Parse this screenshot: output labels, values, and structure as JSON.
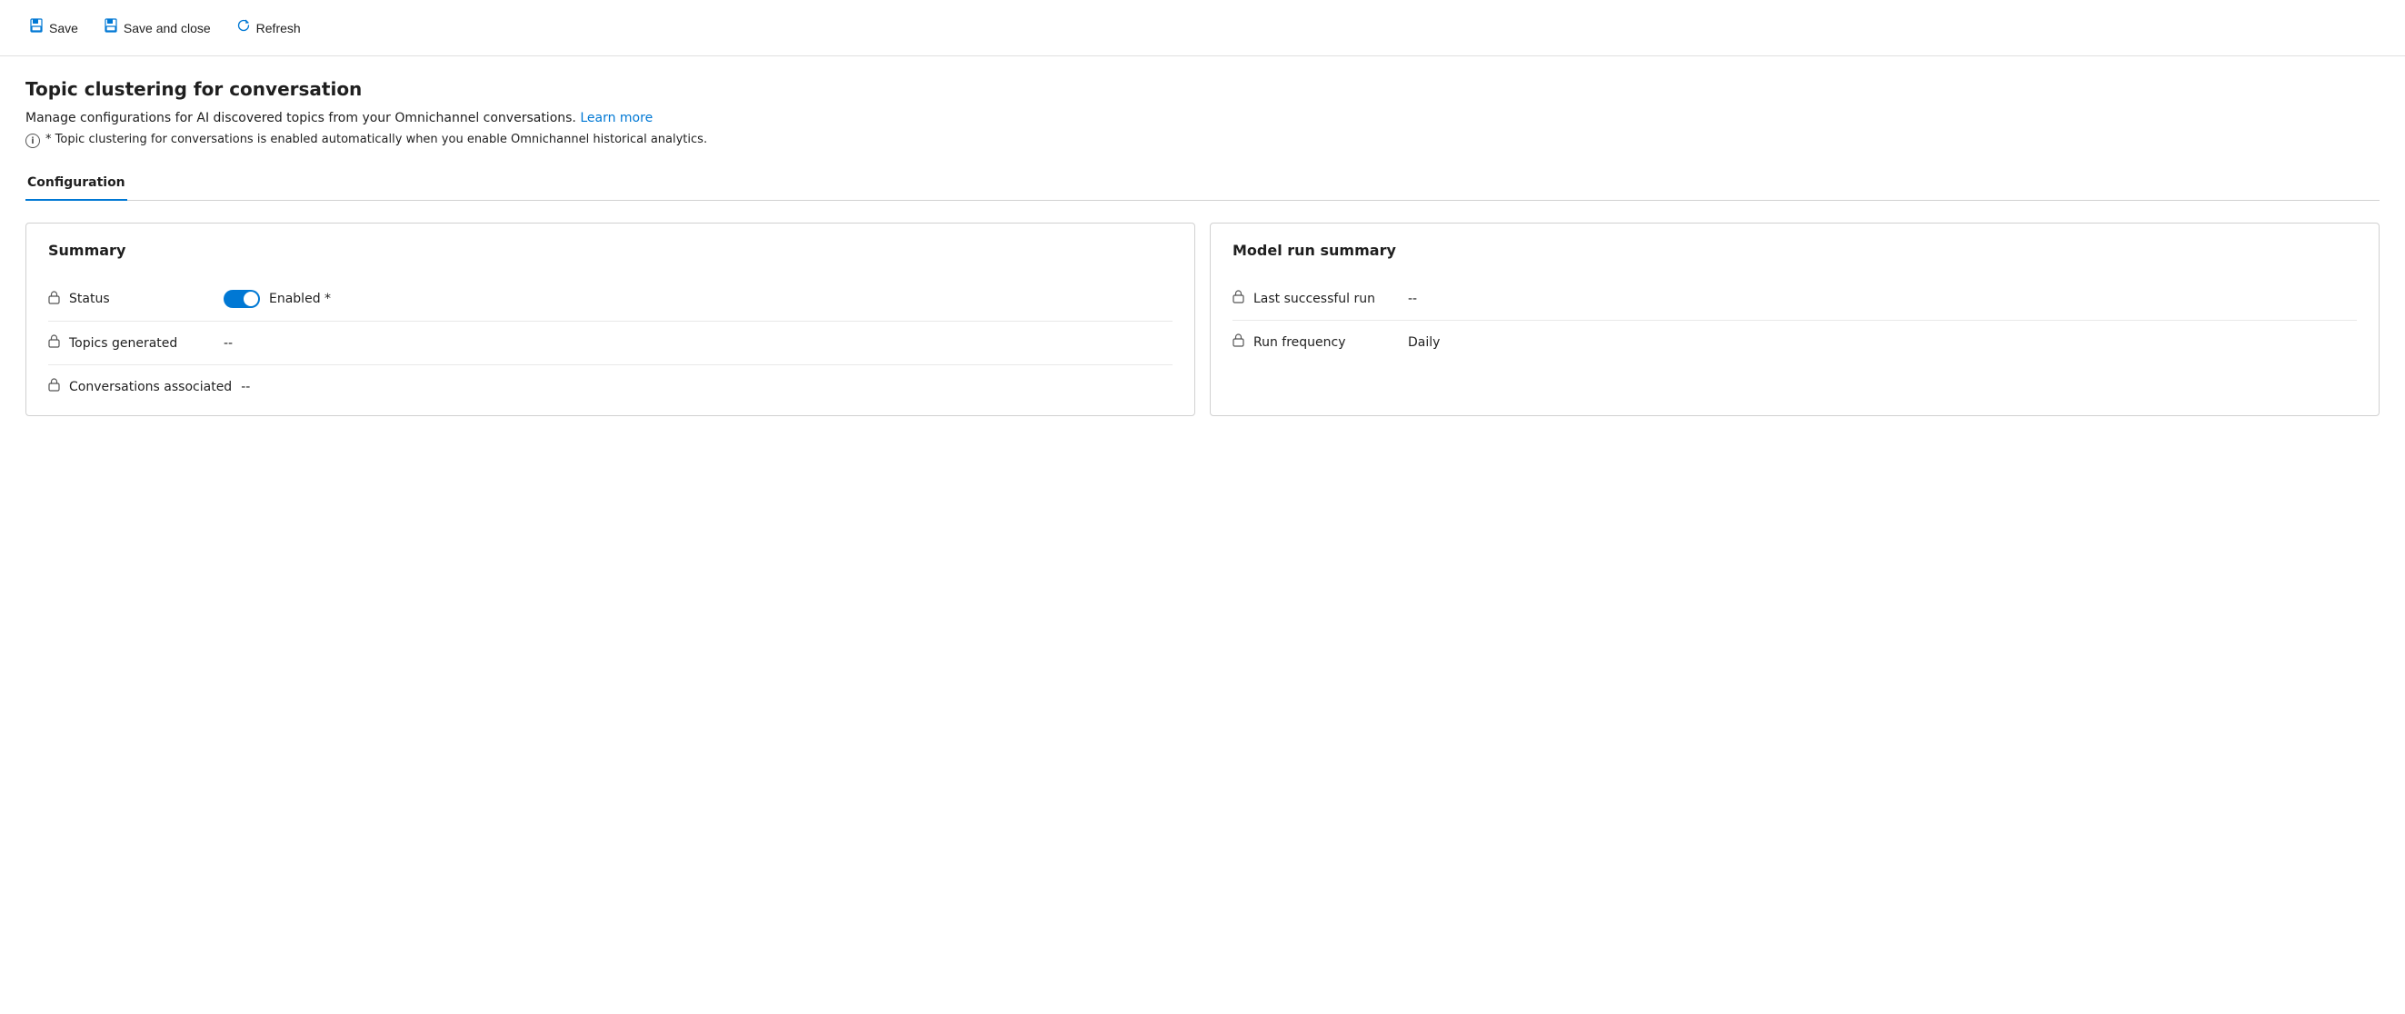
{
  "toolbar": {
    "save_label": "Save",
    "save_close_label": "Save and close",
    "refresh_label": "Refresh"
  },
  "page": {
    "title": "Topic clustering for conversation",
    "description": "Manage configurations for AI discovered topics from your Omnichannel conversations.",
    "learn_more_label": "Learn more",
    "info_text": "* Topic clustering for conversations is enabled automatically when you enable Omnichannel historical analytics."
  },
  "tabs": [
    {
      "label": "Configuration",
      "active": true
    }
  ],
  "summary_card": {
    "title": "Summary",
    "fields": [
      {
        "label": "Status",
        "type": "toggle",
        "toggle_enabled": true,
        "toggle_label": "Enabled *"
      },
      {
        "label": "Topics generated",
        "value": "--"
      },
      {
        "label": "Conversations associated",
        "value": "--"
      }
    ]
  },
  "model_run_summary_card": {
    "title": "Model run summary",
    "fields": [
      {
        "label": "Last successful run",
        "value": "--"
      },
      {
        "label": "Run frequency",
        "value": "Daily"
      }
    ]
  }
}
